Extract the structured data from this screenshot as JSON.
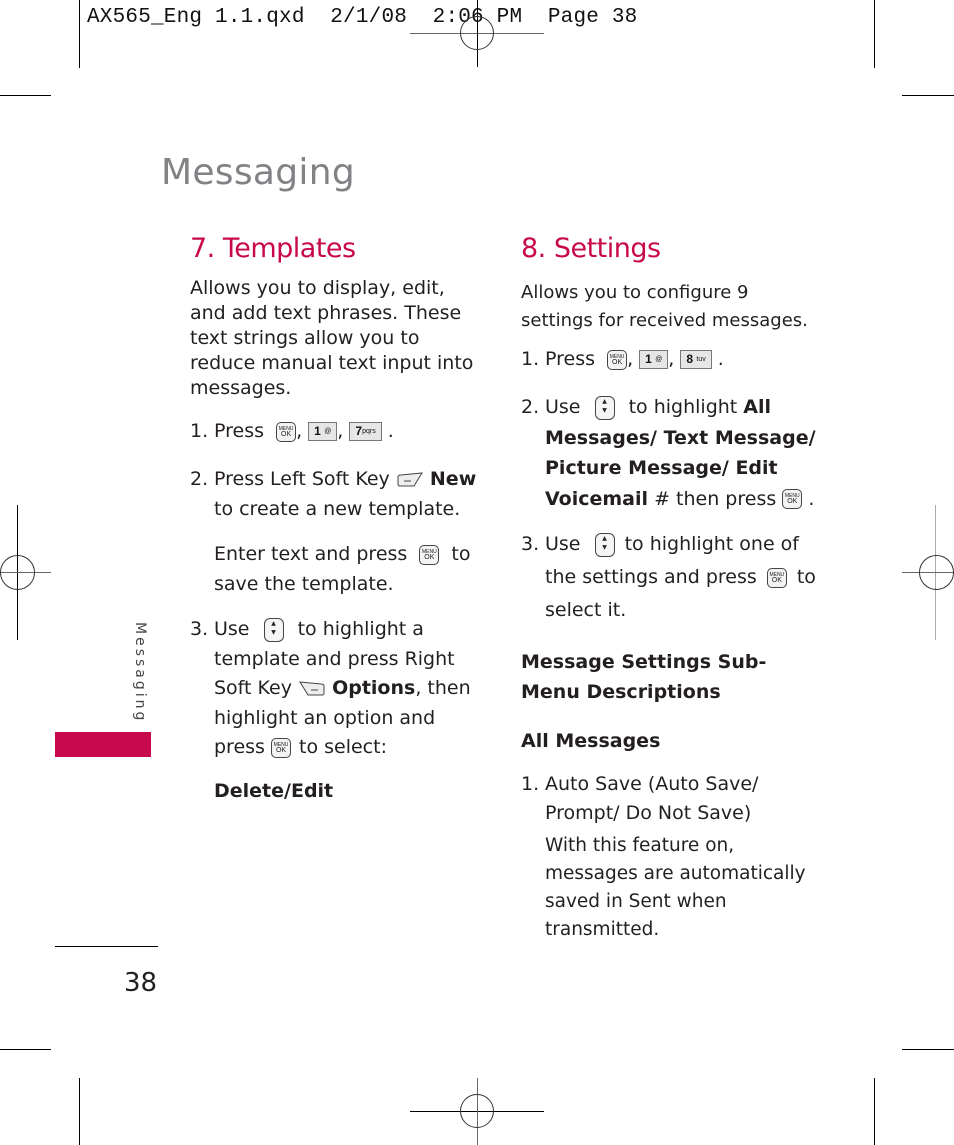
{
  "slug": "AX565_Eng 1.1.qxd  2/1/08  2:06 PM  Page 38",
  "chapter_title": "Messaging",
  "side_tab": {
    "label": "Messaging",
    "color": "#c8084d"
  },
  "page_number": "38",
  "accent_color": "#c8084d",
  "left": {
    "heading": "7. Templates",
    "intro": "Allows you to display, edit, and add text phrases. These text strings allow you to reduce manual text input into messages.",
    "step1": {
      "num": "1.",
      "text": "Press",
      "keys": [
        "menu-ok-key",
        "1-key",
        "7-key"
      ],
      "key1": "1",
      "key1_sub": "@",
      "key2": "7",
      "key2_sub": "pqrs"
    },
    "step2": {
      "num": "2.",
      "pre": "Press Left Soft Key",
      "bold": "New",
      "post": "to create a new template.",
      "sub_pre": "Enter text and press",
      "sub_post": "to save the template."
    },
    "step3": {
      "num": "3.",
      "pre": "Use",
      "mid": "to highlight a template and press Right Soft Key",
      "bold": "Options",
      "post": ", then highlight an option and press",
      "end": "to select:"
    },
    "option": "Delete/Edit"
  },
  "right": {
    "heading": "8. Settings",
    "intro": "Allows you to configure 9 settings for received messages.",
    "step1": {
      "num": "1.",
      "text": "Press",
      "key1": "1",
      "key1_sub": "@",
      "key2": "8",
      "key2_sub": "tuv"
    },
    "step2": {
      "num": "2.",
      "pre": "Use",
      "mid": "to highlight",
      "bold": "All Messages/ Text Message/ Picture Message/ Edit Voicemail",
      "post": "# then press"
    },
    "step3": {
      "num": "3.",
      "pre": "Use",
      "mid": "to highlight one of the settings and press",
      "post": "to select it."
    },
    "subheading": "Message Settings Sub-Menu Descriptions",
    "section": "All Messages",
    "item1": {
      "num": "1.",
      "title": "Auto Save (Auto Save/ Prompt/ Do Not Save)",
      "desc": "With this feature on, messages are automatically saved in Sent when transmitted."
    }
  },
  "keys": {
    "menu_top": "MENU",
    "menu_bottom": "OK"
  }
}
